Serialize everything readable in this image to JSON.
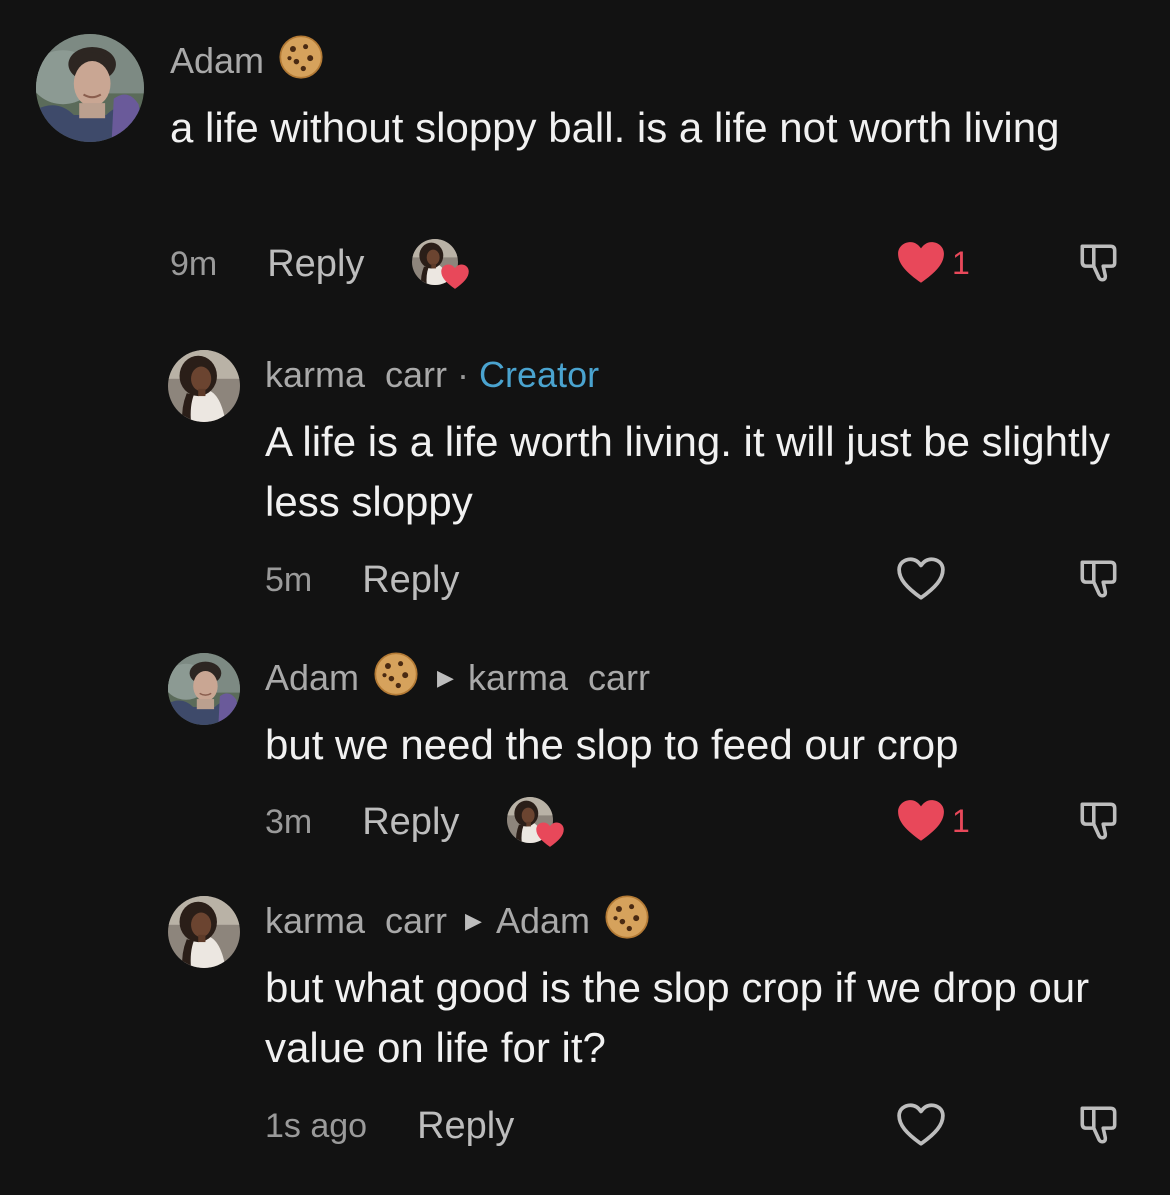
{
  "comments": [
    {
      "author": "Adam",
      "author_badge": "cookie-emoji",
      "text": "a life without sloppy ball. is a life not worth living",
      "time": "9m",
      "reply_label": "Reply",
      "liked_by_creator": true,
      "liked": true,
      "like_count": "1"
    },
    {
      "author": "karma  carr",
      "separator": "·",
      "role": "Creator",
      "text": "A life is a life worth living. it will just be slightly less sloppy",
      "time": "5m",
      "reply_label": "Reply",
      "liked": false
    },
    {
      "author": "Adam",
      "author_badge": "cookie-emoji",
      "reply_to": "karma  carr",
      "text": "but we need the slop to feed our crop",
      "time": "3m",
      "reply_label": "Reply",
      "liked_by_creator": true,
      "liked": true,
      "like_count": "1"
    },
    {
      "author": "karma  carr",
      "reply_to": "Adam",
      "reply_to_badge": "cookie-emoji",
      "text": "but what good is the slop crop if we drop our value on life for it?",
      "time": "1s ago",
      "reply_label": "Reply",
      "liked": false
    }
  ],
  "colors": {
    "background": "#121212",
    "text": "#f1f1f1",
    "muted": "#a9a9a9",
    "creator": "#4aa3cf",
    "like": "#e8485a"
  }
}
